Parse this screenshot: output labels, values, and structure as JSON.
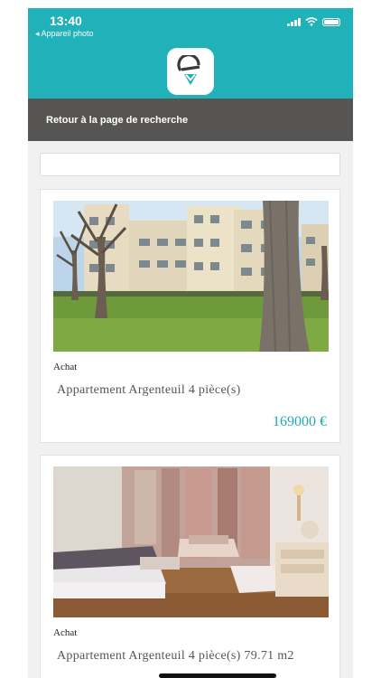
{
  "status_bar": {
    "time": "13:40",
    "back_app": "◂ Appareil photo"
  },
  "header": {
    "logo_icon": "logo-e-location-icon",
    "accent_color": "#20b1b9"
  },
  "nav": {
    "back_label": "Retour à la page de recherche",
    "bg_color": "#575553"
  },
  "search": {
    "value": ""
  },
  "listings": [
    {
      "type": "Achat",
      "title": "Appartement Argenteuil 4 pièce(s)",
      "price": "169000 €"
    },
    {
      "type": "Achat",
      "title": "Appartement Argenteuil 4 pièce(s) 79.71 m2",
      "price": ""
    }
  ]
}
